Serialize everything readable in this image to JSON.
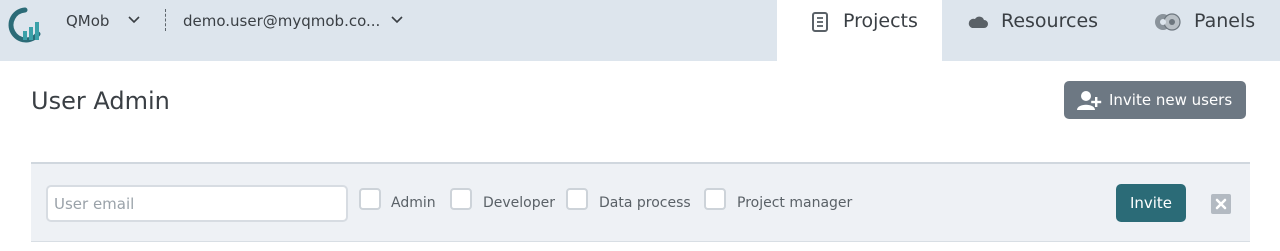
{
  "topbar": {
    "org_name": "QMob",
    "user_email": "demo.user@myqmob.co...",
    "tabs": [
      {
        "label": "Projects",
        "icon": "document-icon",
        "active": true
      },
      {
        "label": "Resources",
        "icon": "cloud-icon",
        "active": false
      },
      {
        "label": "Panels",
        "icon": "panels-icon",
        "active": false
      }
    ]
  },
  "header": {
    "title": "User Admin",
    "invite_new_label": "Invite new users"
  },
  "invite_panel": {
    "email_placeholder": "User email",
    "roles": [
      {
        "label": "Admin",
        "checked": false
      },
      {
        "label": "Developer",
        "checked": false
      },
      {
        "label": "Data process",
        "checked": false
      },
      {
        "label": "Project manager",
        "checked": false
      }
    ],
    "invite_label": "Invite"
  },
  "colors": {
    "topbar_bg": "#dde5ed",
    "brand_teal": "#2b6b77",
    "secondary_button": "#6d7883",
    "panel_bg": "#eef1f5"
  }
}
